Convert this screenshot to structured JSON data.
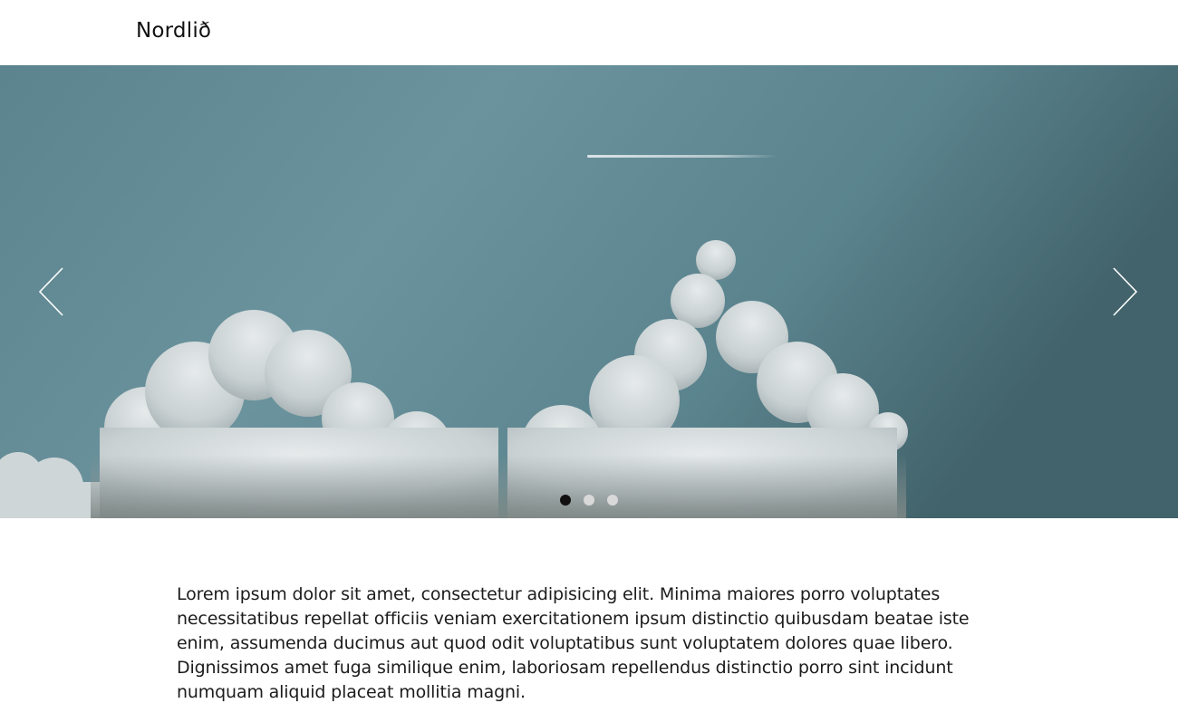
{
  "header": {
    "brand": "Nordlið"
  },
  "slider": {
    "slides": [
      {
        "name": "sky-clouds-contrail"
      },
      {
        "name": "slide-2"
      },
      {
        "name": "slide-3"
      }
    ],
    "active_index": 0,
    "prev_icon": "chevron-left-icon",
    "next_icon": "chevron-right-icon"
  },
  "content": {
    "paragraph": "Lorem ipsum dolor sit amet, consectetur adipisicing elit. Minima maiores porro voluptates necessitatibus repellat officiis veniam exercitationem ipsum distinctio quibusdam beatae iste enim, assumenda ducimus aut quod odit voluptatibus sunt voluptatem dolores quae libero. Dignissimos amet fuga similique enim, laboriosam repellendus distinctio porro sint incidunt numquam aliquid placeat mollitia magni."
  },
  "colors": {
    "sky": "#6a929c",
    "cloud": "#dfe3e4",
    "dot_active": "#111111",
    "dot_inactive": "#d9d9d9"
  }
}
